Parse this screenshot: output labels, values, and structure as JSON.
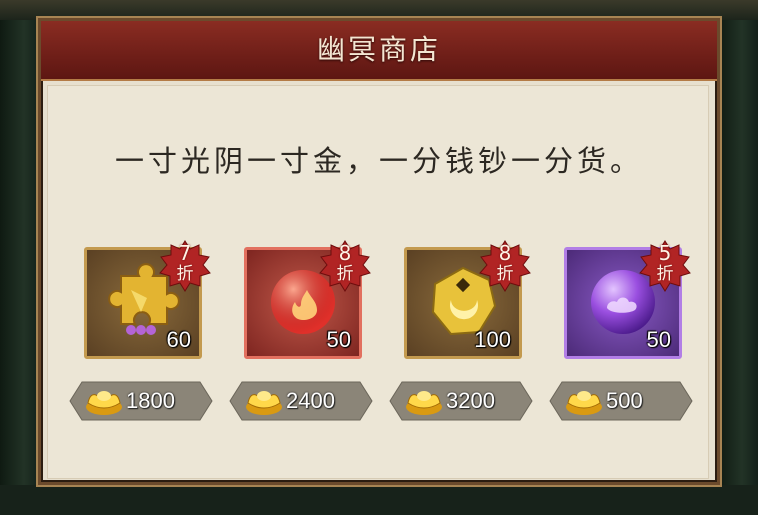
{
  "shop": {
    "title": "幽冥商店",
    "motto": "一寸光阴一寸金，一分钱钞一分货。"
  },
  "items": [
    {
      "icon": "golden-puzzle-icon",
      "count": "60",
      "discount": "7",
      "discount_unit": "折",
      "price": "1800",
      "frame_color": "#c39a4f"
    },
    {
      "icon": "red-fire-orb-icon",
      "count": "50",
      "discount": "8",
      "discount_unit": "折",
      "price": "2400",
      "frame_color": "#e2705f"
    },
    {
      "icon": "golden-moon-ore-icon",
      "count": "100",
      "discount": "8",
      "discount_unit": "折",
      "price": "3200",
      "frame_color": "#c39a4f"
    },
    {
      "icon": "purple-cloud-orb-icon",
      "count": "50",
      "discount": "5",
      "discount_unit": "折",
      "price": "500",
      "frame_color": "#b27ee6"
    }
  ],
  "currency_icon": "gold-ingot-icon",
  "colors": {
    "header": "#7a231b",
    "panel": "#e7e0cf",
    "discount_badge": "#b12424"
  }
}
